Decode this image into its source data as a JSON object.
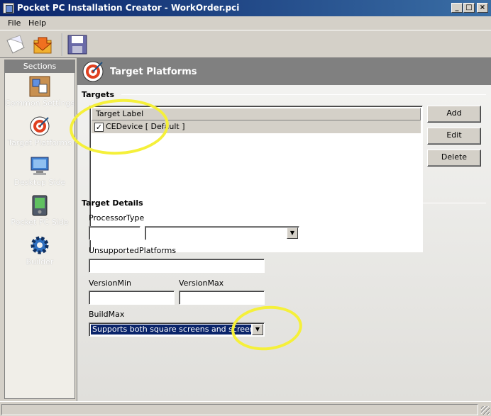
{
  "window": {
    "title": "Pocket PC Installation Creator - WorkOrder.pci",
    "minimize": "_",
    "maximize": "□",
    "close": "×"
  },
  "menu": {
    "items": [
      "File",
      "Help"
    ]
  },
  "toolbar": {
    "buttons": [
      "new-document-icon",
      "open-icon",
      "save-icon"
    ]
  },
  "sidebar": {
    "header": "Sections",
    "items": [
      {
        "label": "Common Settings",
        "icon": "settings-icon"
      },
      {
        "label": "Target Platforms",
        "icon": "target-icon"
      },
      {
        "label": "Desktop Side",
        "icon": "desktop-icon"
      },
      {
        "label": "Pocket PC Side",
        "icon": "pda-icon"
      },
      {
        "label": "Builder",
        "icon": "gear-icon"
      }
    ]
  },
  "panel": {
    "title": "Target Platforms"
  },
  "targets": {
    "group_title": "Targets",
    "column_header": "Target Label",
    "rows": [
      {
        "checked": true,
        "label": "CEDevice [ Default ]"
      }
    ],
    "check_mark": "✓",
    "add_label": "Add",
    "edit_label": "Edit",
    "delete_label": "Delete"
  },
  "details": {
    "group_title": "Target Details",
    "processor_type_label": "ProcessorType",
    "processor_type_value": "",
    "processor_type_select": "",
    "unsupported_platforms_label": "UnsupportedPlatforms",
    "unsupported_platforms_value": "",
    "version_min_label": "VersionMin",
    "version_min_value": "",
    "version_max_label": "VersionMax",
    "version_max_value": "",
    "build_max_label": "BuildMax",
    "build_max_value": "Supports both square screens and screen rotat"
  },
  "colors": {
    "title_start": "#0a246a",
    "title_end": "#3a6ea5",
    "highlight": "#f5f03a",
    "selection": "#0a246a"
  }
}
